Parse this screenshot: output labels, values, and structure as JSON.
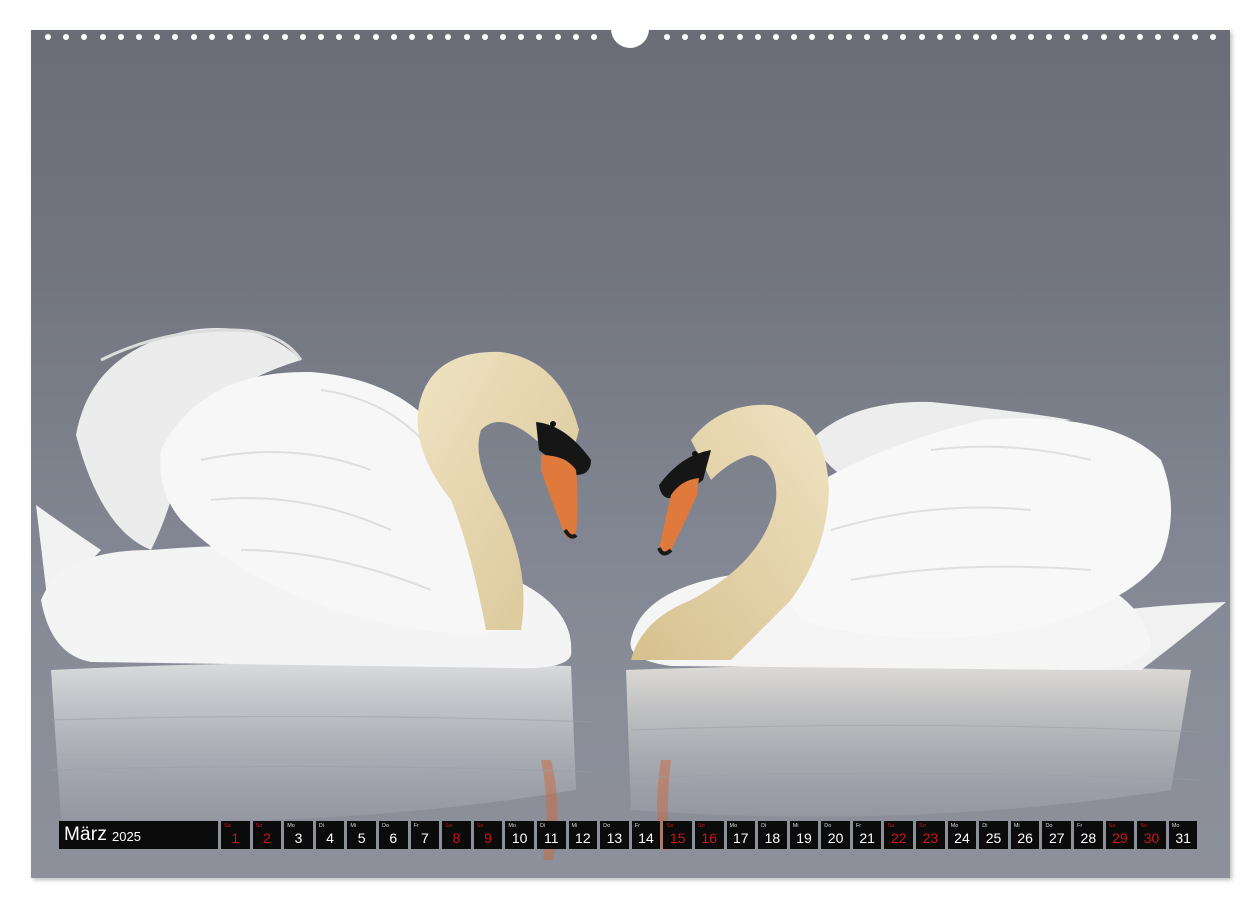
{
  "calendar": {
    "month": "März",
    "year": "2025",
    "days": [
      {
        "wd": "Sa",
        "n": "1",
        "weekend": true
      },
      {
        "wd": "So",
        "n": "2",
        "weekend": true
      },
      {
        "wd": "Mo",
        "n": "3",
        "weekend": false
      },
      {
        "wd": "Di",
        "n": "4",
        "weekend": false
      },
      {
        "wd": "Mi",
        "n": "5",
        "weekend": false
      },
      {
        "wd": "Do",
        "n": "6",
        "weekend": false
      },
      {
        "wd": "Fr",
        "n": "7",
        "weekend": false
      },
      {
        "wd": "Sa",
        "n": "8",
        "weekend": true
      },
      {
        "wd": "So",
        "n": "9",
        "weekend": true
      },
      {
        "wd": "Mo",
        "n": "10",
        "weekend": false
      },
      {
        "wd": "Di",
        "n": "11",
        "weekend": false
      },
      {
        "wd": "Mi",
        "n": "12",
        "weekend": false
      },
      {
        "wd": "Do",
        "n": "13",
        "weekend": false
      },
      {
        "wd": "Fr",
        "n": "14",
        "weekend": false
      },
      {
        "wd": "Sa",
        "n": "15",
        "weekend": true
      },
      {
        "wd": "So",
        "n": "16",
        "weekend": true
      },
      {
        "wd": "Mo",
        "n": "17",
        "weekend": false
      },
      {
        "wd": "Di",
        "n": "18",
        "weekend": false
      },
      {
        "wd": "Mi",
        "n": "19",
        "weekend": false
      },
      {
        "wd": "Do",
        "n": "20",
        "weekend": false
      },
      {
        "wd": "Fr",
        "n": "21",
        "weekend": false
      },
      {
        "wd": "Sa",
        "n": "22",
        "weekend": true
      },
      {
        "wd": "So",
        "n": "23",
        "weekend": true
      },
      {
        "wd": "Mo",
        "n": "24",
        "weekend": false
      },
      {
        "wd": "Di",
        "n": "25",
        "weekend": false
      },
      {
        "wd": "Mi",
        "n": "26",
        "weekend": false
      },
      {
        "wd": "Do",
        "n": "27",
        "weekend": false
      },
      {
        "wd": "Fr",
        "n": "28",
        "weekend": false
      },
      {
        "wd": "Sa",
        "n": "29",
        "weekend": true
      },
      {
        "wd": "So",
        "n": "30",
        "weekend": true
      },
      {
        "wd": "Mo",
        "n": "31",
        "weekend": false
      }
    ]
  },
  "colors": {
    "weekend": "#c8141e",
    "bar": "#0b0b0b",
    "water": "#7b7f8a"
  }
}
